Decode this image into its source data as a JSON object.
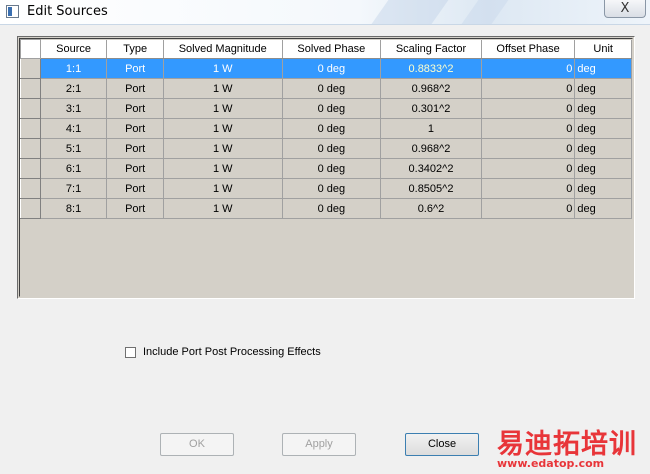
{
  "window": {
    "title": "Edit Sources",
    "close_glyph": "X"
  },
  "table": {
    "columns": [
      "Source",
      "Type",
      "Solved Magnitude",
      "Solved Phase",
      "Scaling Factor",
      "Offset Phase",
      "Unit"
    ],
    "rows": [
      {
        "source": "1:1",
        "type": "Port",
        "magnitude": "1 W",
        "phase": "0 deg",
        "scaling": "0.8833^2",
        "offset": "0",
        "unit": "deg",
        "selected": true
      },
      {
        "source": "2:1",
        "type": "Port",
        "magnitude": "1 W",
        "phase": "0 deg",
        "scaling": "0.968^2",
        "offset": "0",
        "unit": "deg"
      },
      {
        "source": "3:1",
        "type": "Port",
        "magnitude": "1 W",
        "phase": "0 deg",
        "scaling": "0.301^2",
        "offset": "0",
        "unit": "deg"
      },
      {
        "source": "4:1",
        "type": "Port",
        "magnitude": "1 W",
        "phase": "0 deg",
        "scaling": "1",
        "offset": "0",
        "unit": "deg"
      },
      {
        "source": "5:1",
        "type": "Port",
        "magnitude": "1 W",
        "phase": "0 deg",
        "scaling": "0.968^2",
        "offset": "0",
        "unit": "deg"
      },
      {
        "source": "6:1",
        "type": "Port",
        "magnitude": "1 W",
        "phase": "0 deg",
        "scaling": "0.3402^2",
        "offset": "0",
        "unit": "deg"
      },
      {
        "source": "7:1",
        "type": "Port",
        "magnitude": "1 W",
        "phase": "0 deg",
        "scaling": "0.8505^2",
        "offset": "0",
        "unit": "deg"
      },
      {
        "source": "8:1",
        "type": "Port",
        "magnitude": "1 W",
        "phase": "0 deg",
        "scaling": "0.6^2",
        "offset": "0",
        "unit": "deg"
      }
    ]
  },
  "options": {
    "include_post_processing_label": "Include Port Post Processing Effects",
    "include_post_processing_checked": false
  },
  "buttons": {
    "ok": "OK",
    "apply": "Apply",
    "close": "Close"
  },
  "watermark": {
    "text_cn": "易迪拓培训",
    "url": "www.edatop.com"
  },
  "colors": {
    "selection": "#3399ff",
    "grid_background": "#d4d0c8",
    "watermark": "#e8262a"
  }
}
